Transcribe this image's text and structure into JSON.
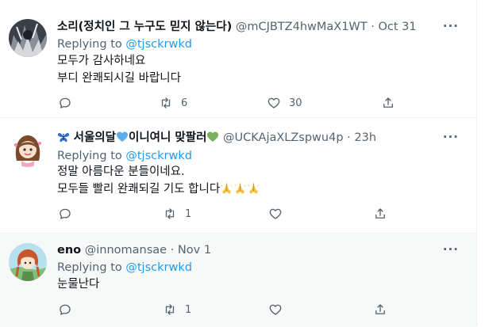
{
  "tweets": [
    {
      "name": "소리(정치인 그 누구도 믿지 않는다)",
      "handle": "@mCJBTZ4hwMaX1WT",
      "sep": "·",
      "time": "Oct 31",
      "more": "···",
      "replying_prefix": "Replying to ",
      "replying_handle": "@tjsckrwkd",
      "lines": [
        "모두가 감사하네요",
        "부디 완쾌되시길 바랍니다"
      ],
      "reply_count": "",
      "retweet_count": "6",
      "like_count": "30"
    },
    {
      "name_parts": [
        "서울의달",
        "이니여니 맞팔러"
      ],
      "name_emoji": [
        "butterfly-icon",
        "blue-heart-icon",
        "green-heart-icon"
      ],
      "handle": "@UCKAjaXLZspwu4p",
      "sep": "·",
      "time": "23h",
      "more": "···",
      "replying_prefix": "Replying to ",
      "replying_handle": "@tjsckrwkd",
      "lines": [
        "정말 아름다운 분들이네요.",
        "모두들 빨리 완쾌되길 기도 합니다"
      ],
      "line_emoji": [
        "folded-hands-icon",
        "folded-hands-icon",
        "folded-hands-icon"
      ],
      "reply_count": "",
      "retweet_count": "1",
      "like_count": ""
    },
    {
      "name": "eno",
      "handle": "@innomansae",
      "sep": "·",
      "time": "Nov 1",
      "more": "···",
      "replying_prefix": "Replying to ",
      "replying_handle": "@tjsckrwkd",
      "lines": [
        "눈물난다"
      ],
      "reply_count": "",
      "retweet_count": "1",
      "like_count": ""
    }
  ],
  "colors": {
    "link": "#1d9bf0",
    "secondary_text": "#536471",
    "primary_text": "#0f1419",
    "divider": "#eff3f4",
    "highlight_bg": "#f7f9f9"
  }
}
